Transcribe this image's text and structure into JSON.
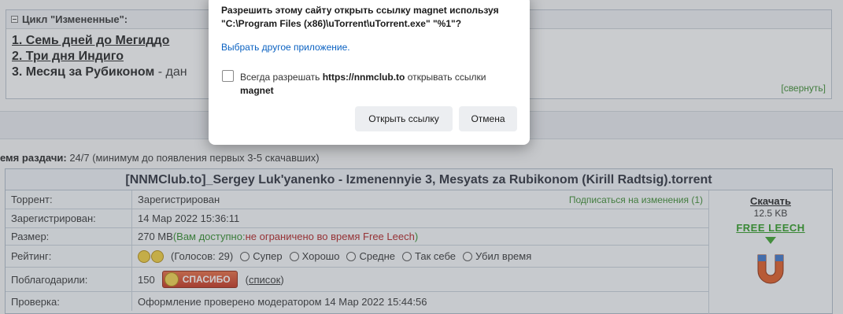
{
  "dialog": {
    "question_line1": "Разрешить этому сайту открыть ссылку magnet используя",
    "question_line2": "\"C:\\Program Files (x86)\\uTorrent\\uTorrent.exe\" \"%1\"?",
    "choose_other": "Выбрать другое приложение.",
    "always_prefix": "Всегда разрешать ",
    "always_site": "https://nnmclub.to",
    "always_suffix": " открывать ссылки",
    "always_scheme": "magnet",
    "open_button": "Открыть ссылку",
    "cancel_button": "Отмена"
  },
  "series": {
    "header": "Цикл \"Измененные\":",
    "items": [
      {
        "label": "1. Семь дней до Мегиддо"
      },
      {
        "label": "2. Три дня Индиго"
      },
      {
        "label": "3. Месяц за Рубиконом",
        "rest": " - дан"
      }
    ],
    "collapse": "[свернуть]"
  },
  "seed": {
    "label": "емя раздачи:",
    "value": " 24/7 (минимум до появления первых 3-5 скачавших)"
  },
  "torrent": {
    "title": "[NNMClub.to]_Sergey Luk'yanenko - Izmenennyie 3, Mesyats za Rubikonom (Kirill Radtsig).torrent",
    "rows": {
      "torrent_label": "Торрент:",
      "torrent_value": "Зарегистрирован",
      "subscribe": "Подписаться на изменения (1)",
      "registered_label": "Зарегистрирован:",
      "registered_value": "14 Мар 2022 15:36:11",
      "size_label": "Размер:",
      "size_value": "270 MB",
      "size_avail_open": " (Вам доступно: ",
      "size_avail_value": "не ограничено во время Free Leech",
      "size_avail_close": ")",
      "rating_label": "Рейтинг:",
      "votes": "(Голосов: 29)",
      "rating_options": [
        "Супер",
        "Хорошо",
        "Средне",
        "Так себе",
        "Убил время"
      ],
      "thanks_label": "Поблагодарили:",
      "thanks_count": "150",
      "thanks_button": "СПАСИБО",
      "thanks_list": "список",
      "check_label": "Проверка:",
      "check_value": "Оформление проверено модератором 14 Мар 2022 15:44:56"
    },
    "download": {
      "link": "Скачать",
      "size": "12.5 KB",
      "free_leech": "FREE LEECH"
    }
  },
  "colors": {
    "link_blue": "#0b62c2",
    "green": "#2f8a28",
    "red": "#b02020",
    "button_bg": "#eceef1"
  },
  "icons": [
    "minus-box-icon",
    "smiley-rating-icon",
    "spasibo-face-icon",
    "green-down-arrow-icon",
    "magnet-icon"
  ]
}
